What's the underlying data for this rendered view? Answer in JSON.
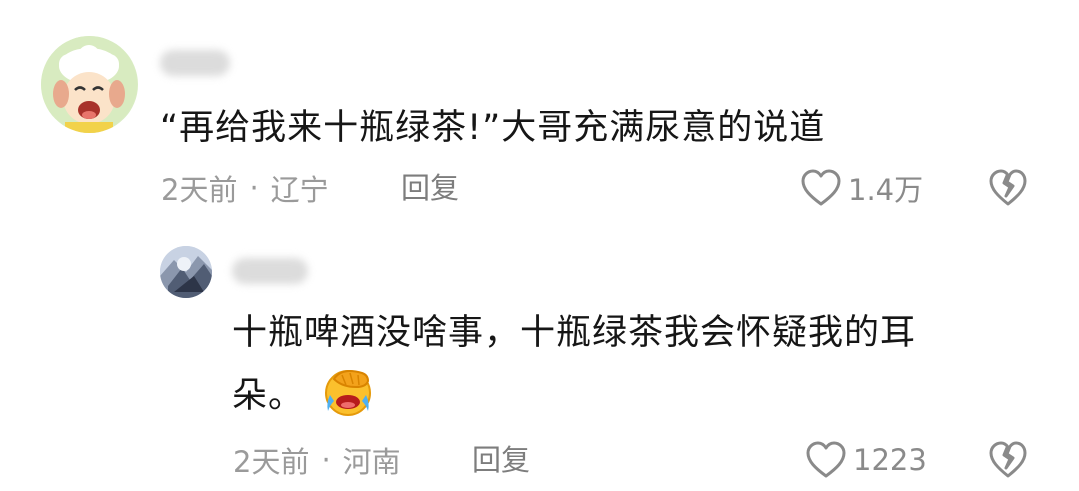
{
  "comment": {
    "text": "“再给我来十瓶绿茶!”大哥充满尿意的说道",
    "time": "2天前",
    "separator": "·",
    "location": "辽宁",
    "reply_label": "回复",
    "likes": "1.4万",
    "avatar_icon": "lazy-sheep-avatar-icon"
  },
  "reply": {
    "text_line1": "十瓶啤酒没啥事，十瓶绿茶我会怀疑我的耳",
    "text_line2": "朵。",
    "emoji": "face-palm-laughing-emoji",
    "time": "2天前",
    "separator": "·",
    "location": "河南",
    "reply_label": "回复",
    "likes": "1223",
    "avatar_icon": "user-photo-avatar-icon"
  },
  "colors": {
    "text": "#161616",
    "meta": "#9a9a9a",
    "icon": "#8a8a8a"
  }
}
